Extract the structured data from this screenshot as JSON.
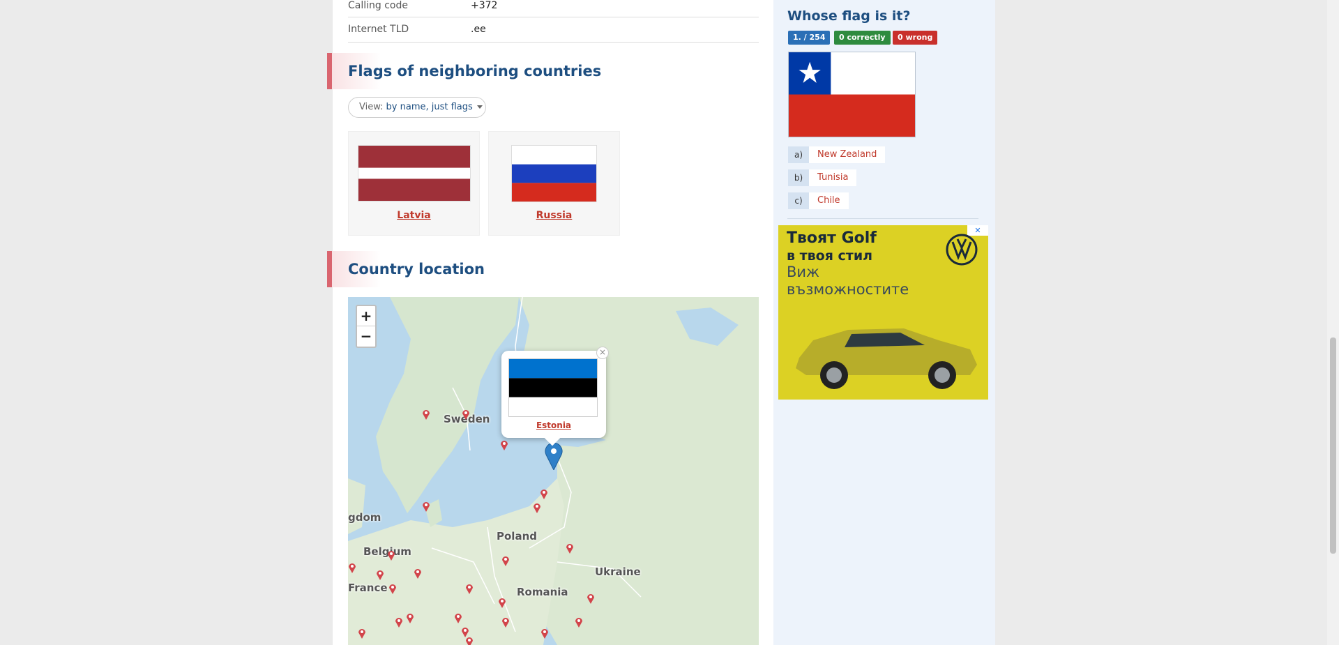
{
  "info": [
    {
      "key": "Calling code",
      "value": "+372"
    },
    {
      "key": "Internet TLD",
      "value": ".ee"
    }
  ],
  "sections": {
    "neighbors_title": "Flags of neighboring countries",
    "location_title": "Country location"
  },
  "view": {
    "label": "View:",
    "value": "by name, just flags"
  },
  "neighbors": [
    {
      "name": "Latvia"
    },
    {
      "name": "Russia"
    }
  ],
  "map": {
    "zoom_in": "+",
    "zoom_out": "−",
    "labels": {
      "sweden": "Sweden",
      "kingdom": "gdom",
      "poland": "Poland",
      "belgium": "Belgium",
      "ukraine": "Ukraine",
      "france": "France",
      "romania": "Romania"
    },
    "popup": {
      "name": "Estonia",
      "close": "×"
    }
  },
  "quiz": {
    "title": "Whose flag is it?",
    "progress": "1. / 254",
    "correct": "0 correctly",
    "wrong": "0 wrong",
    "answers": [
      {
        "letter": "a)",
        "text": "New Zealand"
      },
      {
        "letter": "b)",
        "text": "Tunisia"
      },
      {
        "letter": "c)",
        "text": "Chile"
      }
    ]
  },
  "ad": {
    "line1": "Твоят Golf",
    "line2": "в твоя стил",
    "line3": "Виж",
    "line4": "възможностите",
    "close": "✕"
  },
  "colors": {
    "accent": "#1d4e80",
    "link": "#c0392b",
    "badge_blue": "#2a6fb6",
    "badge_green": "#2e8b3e",
    "badge_red": "#c9302c"
  }
}
